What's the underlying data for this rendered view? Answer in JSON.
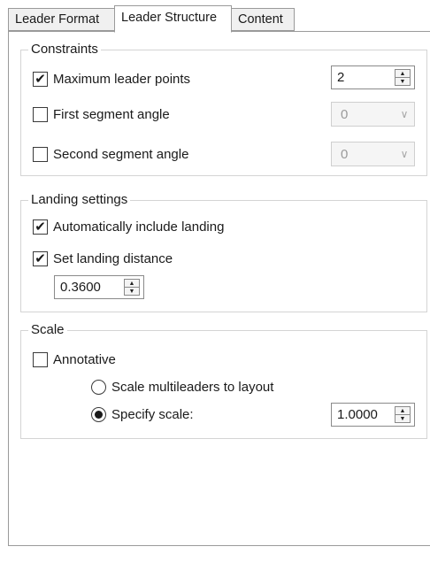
{
  "tabs": [
    {
      "label": "Leader Format"
    },
    {
      "label": "Leader Structure"
    },
    {
      "label": "Content"
    }
  ],
  "constraints": {
    "title": "Constraints",
    "max_points_label": "Maximum leader points",
    "max_points_checked": true,
    "max_points_value": "2",
    "first_angle_label": "First segment angle",
    "first_angle_checked": false,
    "first_angle_value": "0",
    "second_angle_label": "Second segment angle",
    "second_angle_checked": false,
    "second_angle_value": "0"
  },
  "landing": {
    "title": "Landing settings",
    "auto_include_label": "Automatically include landing",
    "auto_include_checked": true,
    "set_distance_label": "Set landing distance",
    "set_distance_checked": true,
    "distance_value": "0.3600"
  },
  "scale": {
    "title": "Scale",
    "annotative_label": "Annotative",
    "annotative_checked": false,
    "to_layout_label": "Scale multileaders to layout",
    "specify_label": "Specify scale:",
    "selected_option": "specify",
    "scale_value": "1.0000"
  },
  "glyphs": {
    "check": "✔",
    "up": "▲",
    "down": "▼",
    "dropdown": "∨"
  }
}
